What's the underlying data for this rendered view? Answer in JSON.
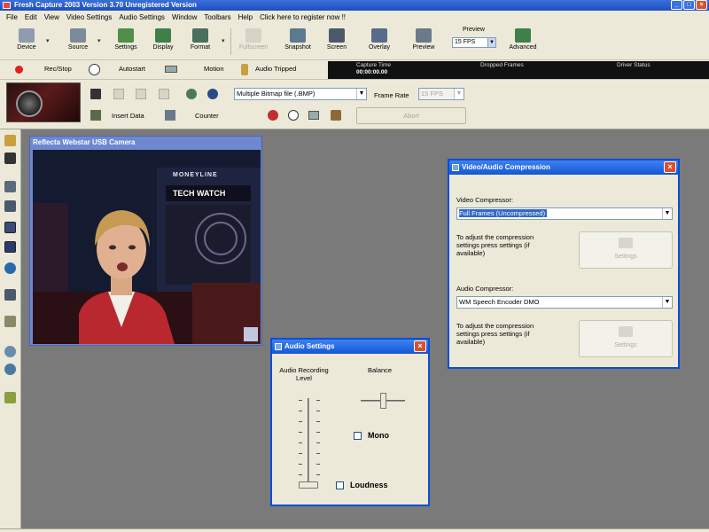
{
  "window": {
    "title": "Fresh Capture 2003 Version 3.70 Unregistered Version"
  },
  "menu": [
    "File",
    "Edit",
    "View",
    "Video Settings",
    "Audio Settings",
    "Window",
    "Toolbars",
    "Help",
    "Click here to register now !!"
  ],
  "toolbar": {
    "buttons": [
      {
        "label": "Device",
        "icon": "camera-icon"
      },
      {
        "label": "Source",
        "icon": "source-icon"
      },
      {
        "label": "Settings",
        "icon": "settings-icon"
      },
      {
        "label": "Display",
        "icon": "display-icon"
      },
      {
        "label": "Format",
        "icon": "format-icon"
      },
      {
        "label": "Fullscreen",
        "icon": "fullscreen-icon"
      },
      {
        "label": "Snapshot",
        "icon": "snapshot-icon"
      },
      {
        "label": "Screen",
        "icon": "screen-icon"
      },
      {
        "label": "Overlay",
        "icon": "overlay-icon"
      },
      {
        "label": "Preview",
        "icon": "preview-icon"
      },
      {
        "label": "Advanced",
        "icon": "advanced-icon"
      }
    ],
    "preview_label": "Preview",
    "preview_fps": "15 FPS"
  },
  "capture_bar": {
    "rec_stop": "Rec/Stop",
    "autostart": "Autostart",
    "motion": "Motion",
    "audio_tripped": "Audio Tripped",
    "status_headers": [
      "Capture Time",
      "Dropped Frames",
      "Driver Status"
    ],
    "capture_time": "00:00:00.00"
  },
  "options_bar": {
    "format_value": "Multiple Bitmap file (.BMP)",
    "frame_rate_label": "Frame Rate",
    "frame_rate_value": "15 FPS",
    "insert_data": "Insert Data",
    "counter": "Counter",
    "abort": "Abort"
  },
  "video_window": {
    "title": "Reflecta Webstar USB Camera",
    "overlay_text_1": "MONEYLINE",
    "overlay_text_2": "TECH WATCH"
  },
  "video_audio_dialog": {
    "title": "Video/Audio Compression",
    "video_compressor_label": "Video Compressor:",
    "video_compressor_value": "Full Frames (Uncompressed)",
    "video_note": "To adjust the compression settings press settings (if available)",
    "settings_label": "Settings",
    "audio_compressor_label": "Audio Compressor:",
    "audio_compressor_value": "WM Speech Encoder DMO",
    "audio_note": "To adjust the compression settings press settings (if available)"
  },
  "audio_settings": {
    "title": "Audio Settings",
    "recording_level_label": "Audio Recording Level",
    "balance_label": "Balance",
    "mono_label": "Mono",
    "loudness_label": "Loudness"
  },
  "colors": {
    "xp_blue": "#1456d4",
    "close_red": "#d8512e",
    "selection": "#316ac5"
  }
}
